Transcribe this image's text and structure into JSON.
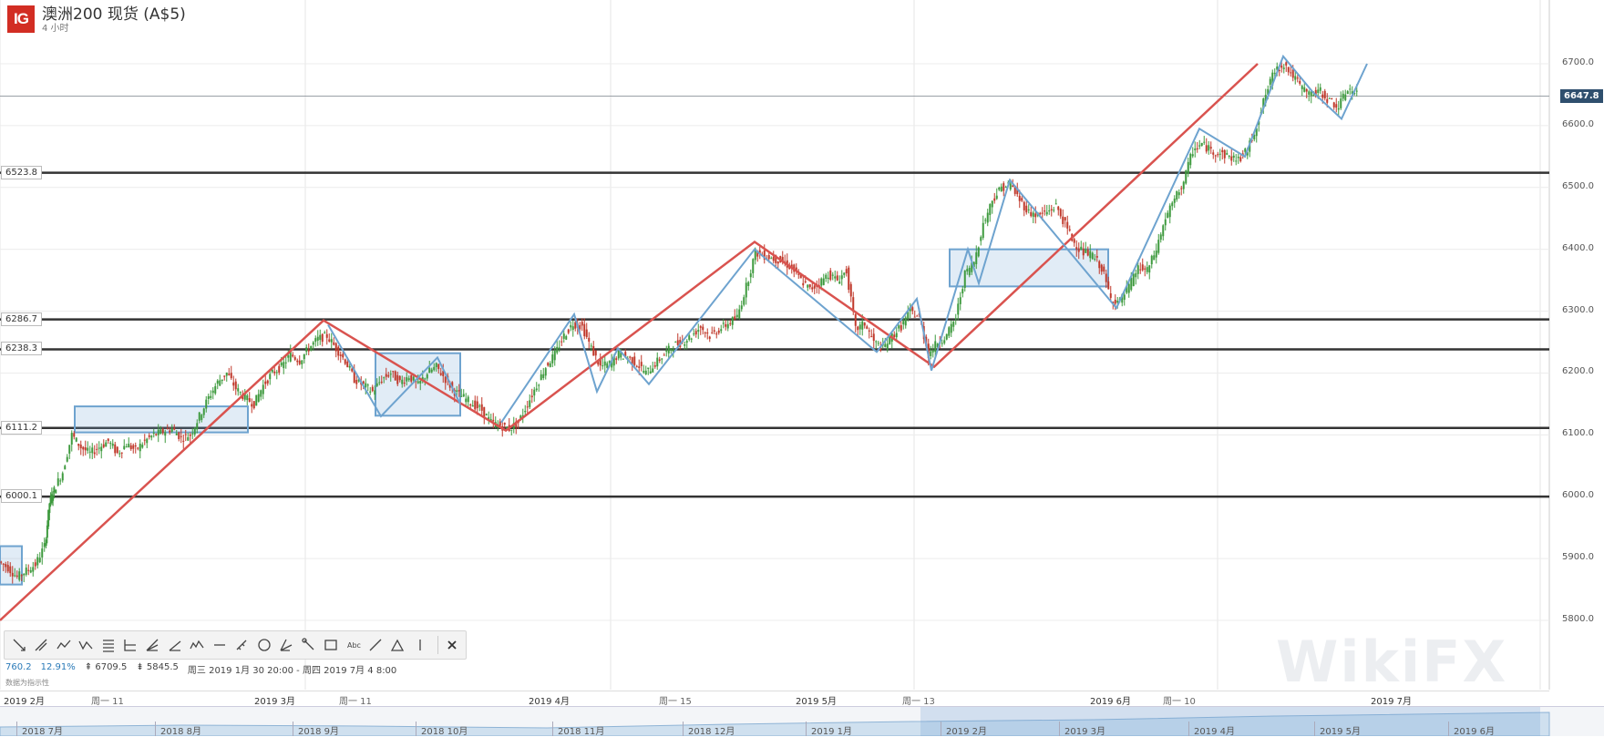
{
  "header": {
    "logo_text": "IG",
    "title": "澳洲200 现货 (A$5)",
    "subtitle": "4 小时"
  },
  "stats": {
    "s1": "760.2",
    "s2": "12.91%",
    "s3": "6709.5",
    "s4": "5845.5",
    "range": "周三 2019 1月 30 20:00 - 周四 2019 7月 4 8:00"
  },
  "disclaimer": "数据为指示性",
  "watermark": "WikiFX",
  "current_price": "6647.8",
  "toolbar": {
    "icons": [
      "arrow-line-icon",
      "parallel-icon",
      "wave-icon",
      "zigzag-icon",
      "grid-icon",
      "fib-icon",
      "fan-icon",
      "angle-icon",
      "elliott-icon",
      "horizontal-line-icon",
      "ruler-icon",
      "circle-icon",
      "pitchfork-icon",
      "path-icon",
      "rectangle-icon",
      "text-icon",
      "line-icon",
      "triangle-icon",
      "vertical-line-icon",
      "close-icon"
    ]
  },
  "chart_data": {
    "type": "candlestick",
    "title": "澳洲200 现货 (A$5)",
    "timeframe": "4 小时",
    "ylim": [
      5760,
      6760
    ],
    "yticks": [
      5800,
      5900,
      6000,
      6100,
      6200,
      6300,
      6400,
      6500,
      6600,
      6700
    ],
    "ytick_labels": [
      "5800.0",
      "5900.0",
      "6000.0",
      "6100.0",
      "6200.0",
      "6300.0",
      "6400.0",
      "6500.0",
      "6600.0",
      "6700.0"
    ],
    "xticks": [
      "2019 2月",
      "周一 11",
      "2019 3月",
      "周一 11",
      "2019 4月",
      "周一 15",
      "2019 5月",
      "周一 13",
      "2019 6月",
      "周一 10",
      "2019 7月"
    ],
    "horizontal_levels": [
      {
        "value": 6523.8,
        "label": "6523.8"
      },
      {
        "value": 6286.7,
        "label": "6286.7"
      },
      {
        "value": 6238.3,
        "label": "6238.3"
      },
      {
        "value": 6111.2,
        "label": "6111.2"
      },
      {
        "value": 6000.1,
        "label": "6000.1"
      }
    ],
    "current_price": 6647.8,
    "price_path": [
      [
        0,
        5895
      ],
      [
        10,
        5885
      ],
      [
        20,
        5870
      ],
      [
        30,
        5880
      ],
      [
        40,
        5890
      ],
      [
        50,
        5920
      ],
      [
        55,
        5990
      ],
      [
        60,
        6010
      ],
      [
        70,
        6040
      ],
      [
        80,
        6100
      ],
      [
        90,
        6080
      ],
      [
        100,
        6070
      ],
      [
        110,
        6080
      ],
      [
        120,
        6090
      ],
      [
        130,
        6070
      ],
      [
        140,
        6085
      ],
      [
        150,
        6075
      ],
      [
        160,
        6090
      ],
      [
        170,
        6100
      ],
      [
        180,
        6105
      ],
      [
        190,
        6110
      ],
      [
        200,
        6095
      ],
      [
        210,
        6100
      ],
      [
        220,
        6130
      ],
      [
        230,
        6160
      ],
      [
        240,
        6185
      ],
      [
        250,
        6200
      ],
      [
        260,
        6175
      ],
      [
        270,
        6160
      ],
      [
        280,
        6150
      ],
      [
        290,
        6180
      ],
      [
        300,
        6200
      ],
      [
        310,
        6210
      ],
      [
        320,
        6230
      ],
      [
        330,
        6220
      ],
      [
        340,
        6240
      ],
      [
        350,
        6255
      ],
      [
        360,
        6260
      ],
      [
        370,
        6240
      ],
      [
        380,
        6220
      ],
      [
        390,
        6190
      ],
      [
        400,
        6180
      ],
      [
        410,
        6170
      ],
      [
        420,
        6190
      ],
      [
        430,
        6200
      ],
      [
        440,
        6185
      ],
      [
        450,
        6195
      ],
      [
        460,
        6180
      ],
      [
        470,
        6200
      ],
      [
        480,
        6210
      ],
      [
        490,
        6190
      ],
      [
        500,
        6170
      ],
      [
        510,
        6160
      ],
      [
        520,
        6150
      ],
      [
        530,
        6140
      ],
      [
        540,
        6120
      ],
      [
        550,
        6115
      ],
      [
        560,
        6110
      ],
      [
        570,
        6120
      ],
      [
        580,
        6150
      ],
      [
        590,
        6180
      ],
      [
        600,
        6210
      ],
      [
        610,
        6230
      ],
      [
        620,
        6260
      ],
      [
        630,
        6280
      ],
      [
        640,
        6275
      ],
      [
        650,
        6240
      ],
      [
        660,
        6210
      ],
      [
        670,
        6215
      ],
      [
        680,
        6230
      ],
      [
        690,
        6225
      ],
      [
        700,
        6215
      ],
      [
        710,
        6200
      ],
      [
        720,
        6215
      ],
      [
        730,
        6230
      ],
      [
        740,
        6245
      ],
      [
        750,
        6250
      ],
      [
        760,
        6260
      ],
      [
        770,
        6275
      ],
      [
        780,
        6260
      ],
      [
        790,
        6270
      ],
      [
        800,
        6280
      ],
      [
        810,
        6290
      ],
      [
        820,
        6340
      ],
      [
        830,
        6395
      ],
      [
        840,
        6390
      ],
      [
        850,
        6385
      ],
      [
        860,
        6380
      ],
      [
        870,
        6370
      ],
      [
        880,
        6350
      ],
      [
        890,
        6335
      ],
      [
        900,
        6345
      ],
      [
        910,
        6360
      ],
      [
        920,
        6350
      ],
      [
        930,
        6365
      ],
      [
        940,
        6270
      ],
      [
        950,
        6280
      ],
      [
        960,
        6250
      ],
      [
        970,
        6240
      ],
      [
        980,
        6260
      ],
      [
        990,
        6275
      ],
      [
        1000,
        6300
      ],
      [
        1010,
        6290
      ],
      [
        1020,
        6230
      ],
      [
        1030,
        6250
      ],
      [
        1040,
        6260
      ],
      [
        1050,
        6290
      ],
      [
        1060,
        6360
      ],
      [
        1070,
        6380
      ],
      [
        1080,
        6440
      ],
      [
        1090,
        6480
      ],
      [
        1100,
        6500
      ],
      [
        1110,
        6505
      ],
      [
        1120,
        6480
      ],
      [
        1130,
        6460
      ],
      [
        1140,
        6455
      ],
      [
        1150,
        6460
      ],
      [
        1160,
        6470
      ],
      [
        1170,
        6440
      ],
      [
        1180,
        6410
      ],
      [
        1190,
        6395
      ],
      [
        1200,
        6390
      ],
      [
        1210,
        6370
      ],
      [
        1220,
        6320
      ],
      [
        1230,
        6315
      ],
      [
        1240,
        6340
      ],
      [
        1250,
        6370
      ],
      [
        1260,
        6365
      ],
      [
        1270,
        6400
      ],
      [
        1280,
        6450
      ],
      [
        1290,
        6480
      ],
      [
        1300,
        6510
      ],
      [
        1310,
        6560
      ],
      [
        1320,
        6570
      ],
      [
        1330,
        6560
      ],
      [
        1340,
        6555
      ],
      [
        1350,
        6550
      ],
      [
        1360,
        6545
      ],
      [
        1370,
        6560
      ],
      [
        1380,
        6600
      ],
      [
        1390,
        6650
      ],
      [
        1400,
        6690
      ],
      [
        1410,
        6700
      ],
      [
        1420,
        6680
      ],
      [
        1430,
        6660
      ],
      [
        1440,
        6650
      ],
      [
        1450,
        6655
      ],
      [
        1460,
        6640
      ],
      [
        1470,
        6630
      ],
      [
        1480,
        6660
      ],
      [
        1490,
        6650
      ]
    ],
    "annotations": {
      "trendlines_red": [
        [
          [
            0,
            5800
          ],
          [
            355,
            6285
          ],
          [
            555,
            6107
          ],
          [
            828,
            6412
          ],
          [
            1025,
            6210
          ],
          [
            1380,
            6700
          ]
        ]
      ],
      "zigzag_blue": [
        [
          [
            360,
            6278
          ],
          [
            418,
            6130
          ],
          [
            480,
            6225
          ],
          [
            505,
            6150
          ]
        ],
        [
          [
            550,
            6120
          ],
          [
            630,
            6295
          ],
          [
            655,
            6170
          ],
          [
            678,
            6240
          ],
          [
            712,
            6182
          ],
          [
            828,
            6400
          ],
          [
            962,
            6234
          ],
          [
            1006,
            6320
          ],
          [
            1022,
            6204
          ],
          [
            1062,
            6400
          ],
          [
            1074,
            6345
          ],
          [
            1108,
            6512
          ],
          [
            1225,
            6305
          ],
          [
            1316,
            6595
          ],
          [
            1366,
            6550
          ],
          [
            1408,
            6712
          ],
          [
            1440,
            6655
          ],
          [
            1472,
            6611
          ],
          [
            1500,
            6700
          ]
        ]
      ],
      "boxes_blue": [
        [
          [
            0,
            5858
          ],
          [
            24,
            5920
          ]
        ],
        [
          [
            82,
            6104
          ],
          [
            272,
            6146
          ]
        ],
        [
          [
            412,
            6131
          ],
          [
            505,
            6232
          ]
        ],
        [
          [
            1042,
            6340
          ],
          [
            1216,
            6400
          ]
        ]
      ]
    }
  },
  "navigator": {
    "labels": [
      "2018 7月",
      "2018 8月",
      "2018 9月",
      "2018 10月",
      "2018 11月",
      "2018 12月",
      "2019 1月",
      "2019 2月",
      "2019 3月",
      "2019 4月",
      "2019 5月",
      "2019 6月"
    ]
  }
}
